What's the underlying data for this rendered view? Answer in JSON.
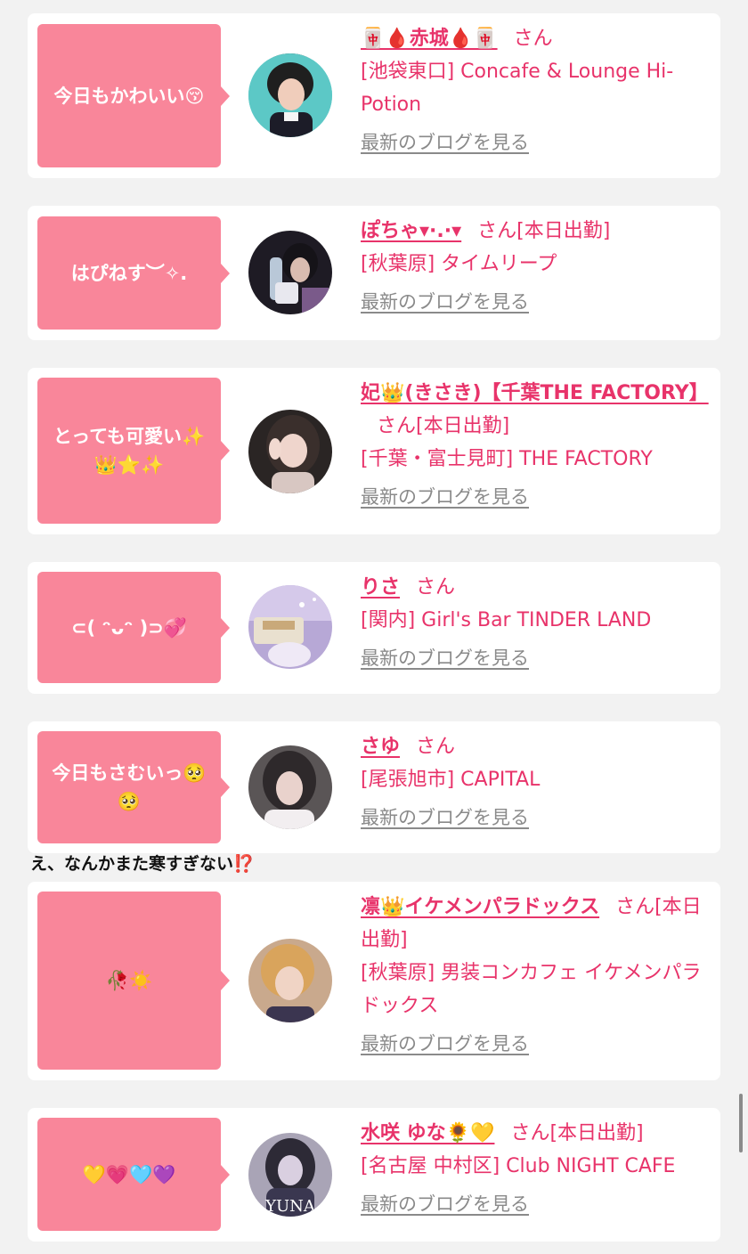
{
  "entries": [
    {
      "comment": "今日もかわいい😚",
      "name": "🀄🩸赤城🩸🀄",
      "suffix": "さん",
      "shop": "[池袋東口] Concafe & Lounge Hi-Potion",
      "blog": "最新のブログを見る"
    },
    {
      "comment": "はぴねす︶✧.",
      "name": "ぽちゃ▾·.·▾",
      "suffix": "さん[本日出勤]",
      "shop": "[秋葉原] タイムリープ",
      "blog": "最新のブログを見る"
    },
    {
      "comment": "とっても可愛い✨👑⭐✨",
      "name": "妃👑(きさき)【千葉THE FACTORY】",
      "suffix": "さん[本日出勤]",
      "shop": "[千葉・富士見町] THE FACTORY",
      "blog": "最新のブログを見る"
    },
    {
      "comment": "⊂( ᵔᴗᵔ )⊃💞",
      "name": "りさ",
      "suffix": "さん",
      "shop": "[関内] Girl's Bar TINDER LAND",
      "blog": "最新のブログを見る"
    },
    {
      "comment": "今日もさむいっ🥺🥺",
      "name": "さゆ",
      "suffix": "さん",
      "shop": "[尾張旭市] CAPITAL",
      "blog": "最新のブログを見る"
    },
    {
      "comment": "🥀☀️",
      "name": "凛👑イケメンパラドックス",
      "suffix": "さん[本日出勤]",
      "shop": "[秋葉原] 男装コンカフェ イケメンパラドックス",
      "blog": "最新のブログを見る"
    },
    {
      "comment": "💛💗🩵💜",
      "name": "水咲 ゆな🌻💛",
      "suffix": "さん[本日出勤]",
      "shop": "[名古屋 中村区] Club NIGHT CAFE",
      "blog": "最新のブログを見る"
    }
  ],
  "overflow_note": "え、なんかまた寒すぎない⁉️",
  "avatar_watermark": "YUNA",
  "colors": {
    "accent": "#e8336a",
    "bubble": "#f9869a",
    "link_gray": "#8a8a8a"
  }
}
